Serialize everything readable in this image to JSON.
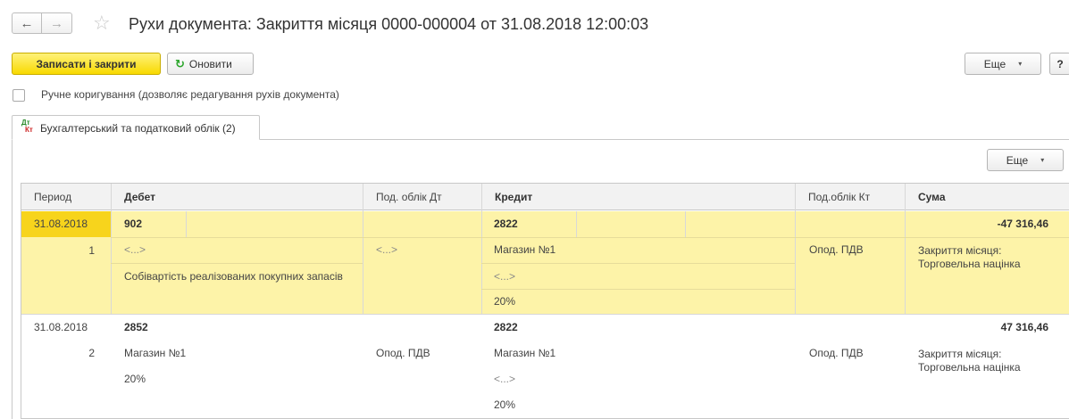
{
  "window": {
    "title": "Рухи документа: Закриття місяця 0000-000004 от 31.08.2018 12:00:03"
  },
  "nav": {
    "back_glyph": "←",
    "forward_glyph": "→",
    "favorite_glyph": "☆"
  },
  "toolbar": {
    "save_close_label": "Записати і закрити",
    "refresh_label": "Оновити",
    "refresh_glyph": "↻",
    "more_label": "Еще",
    "more_caret": "▾",
    "help_label": "?"
  },
  "manual_edit": {
    "label": "Ручне коригування (дозволяє редагування рухів документа)",
    "checked": false
  },
  "tab": {
    "icon_dt": "Дт",
    "icon_kt": "Кт",
    "label": "Бухгалтерський та податковий облік (2)"
  },
  "table_toolbar": {
    "more_label": "Еще",
    "more_caret": "▾"
  },
  "table": {
    "columns": {
      "period": "Период",
      "debit": "Дебет",
      "debit_tax": "Под. облік Дт",
      "credit": "Кредит",
      "credit_tax": "Под.облік Кт",
      "sum": "Сума"
    },
    "rows": [
      {
        "period": "31.08.2018",
        "number": "1",
        "debit_account": "902",
        "debit_sub1": "<...>",
        "debit_sub2": "Собівартість реалізованих покупних запасів",
        "debit_tax": "<...>",
        "credit_account": "2822",
        "credit_sub1": "Магазин №1",
        "credit_sub2": "<...>",
        "credit_sub3": "20%",
        "credit_tax": "Опод. ПДВ",
        "sum": "-47 316,46",
        "content": "Закриття місяця: Торговельна націнка",
        "selected": true
      },
      {
        "period": "31.08.2018",
        "number": "2",
        "debit_account": "2852",
        "debit_sub1": "Магазин №1",
        "debit_sub2": "20%",
        "debit_tax": "Опод. ПДВ",
        "credit_account": "2822",
        "credit_sub1": "Магазин №1",
        "credit_sub2": "<...>",
        "credit_sub3": "20%",
        "credit_tax": "Опод. ПДВ",
        "sum": "47 316,46",
        "content": "Закриття місяця: Торговельна націнка",
        "selected": false
      }
    ]
  },
  "colors": {
    "primary_button": "#f8d900",
    "selected_row": "#fdf3a8",
    "selected_cell": "#f7d41c",
    "refresh_icon": "#2aa52a"
  }
}
